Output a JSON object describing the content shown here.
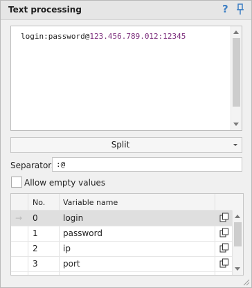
{
  "window": {
    "title": "Text processing"
  },
  "editor": {
    "login_text": "login:password@",
    "host_text": "123.456.789.012:12345"
  },
  "split_button": {
    "label": "Split"
  },
  "separators": {
    "label": "Separators",
    "value": ":@"
  },
  "allow_empty": {
    "label": "Allow empty values",
    "checked": false
  },
  "table": {
    "columns": [
      "No.",
      "Variable name"
    ],
    "rows": [
      {
        "arrow": "→",
        "no": "0",
        "name": "login",
        "selected": true
      },
      {
        "arrow": "",
        "no": "1",
        "name": "password",
        "selected": false
      },
      {
        "arrow": "",
        "no": "2",
        "name": "ip",
        "selected": false
      },
      {
        "arrow": "",
        "no": "3",
        "name": "port",
        "selected": false
      }
    ]
  },
  "icons": {
    "help": "?",
    "pin": "pin-icon",
    "copy": "copy-icon",
    "grip": "resize-grip-icon"
  },
  "colors": {
    "host": "#7b2d7b",
    "help": "#3d7fc4",
    "selected_row": "#dfdfdf"
  }
}
